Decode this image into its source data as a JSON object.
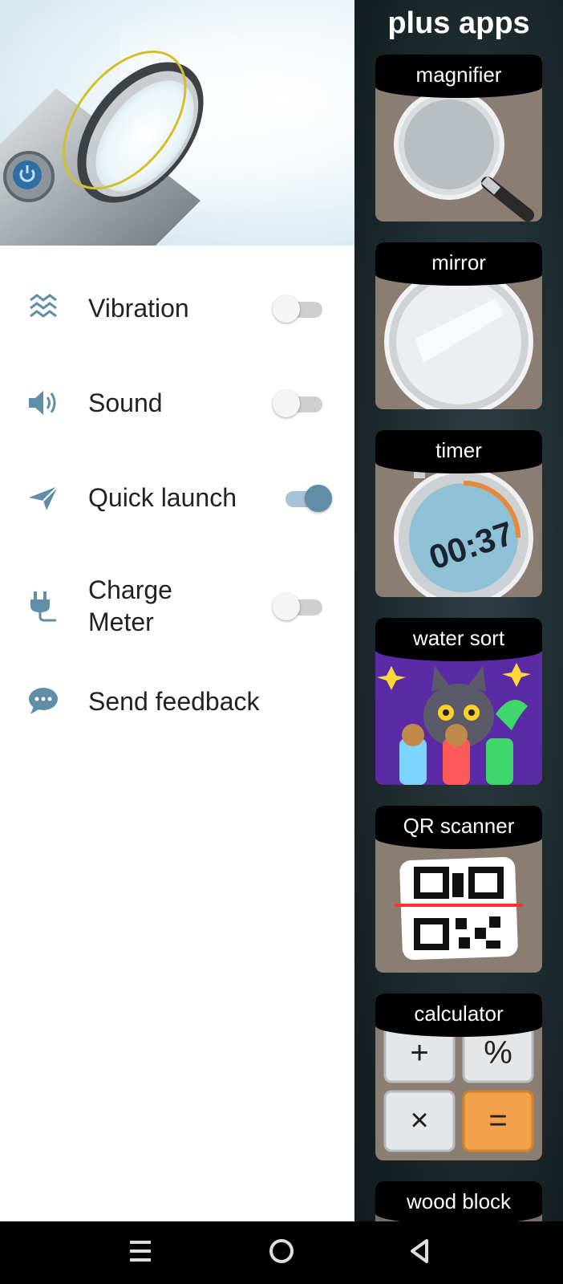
{
  "drawer": {
    "settings": [
      {
        "label": "Vibration",
        "icon": "vibration-icon",
        "toggle": false
      },
      {
        "label": "Sound",
        "icon": "speaker-icon",
        "toggle": false
      },
      {
        "label": "Quick launch",
        "icon": "paper-plane-icon",
        "toggle": true
      },
      {
        "label": "Charge\nMeter",
        "icon": "plug-icon",
        "toggle": false
      },
      {
        "label": "Send feedback",
        "icon": "chat-bubble-icon",
        "toggle": null
      }
    ]
  },
  "plus_apps": {
    "title": "plus apps",
    "apps": [
      {
        "label": "magnifier"
      },
      {
        "label": "mirror"
      },
      {
        "label": "timer",
        "display": "00:37"
      },
      {
        "label": "water sort"
      },
      {
        "label": "QR scanner"
      },
      {
        "label": "calculator",
        "keys": [
          "+",
          "%",
          "×",
          "="
        ]
      },
      {
        "label": "wood block"
      }
    ]
  },
  "colors": {
    "accent": "#5f8ea6",
    "icon": "#5f8ea6",
    "panel": "#1d2a2e"
  }
}
